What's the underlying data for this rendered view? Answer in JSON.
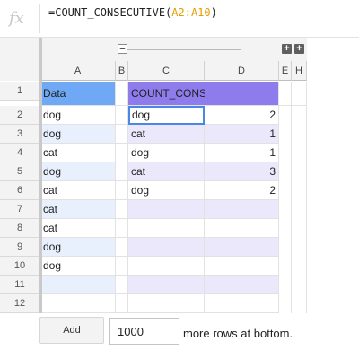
{
  "formula_bar": {
    "fx_icon": "fx-icon",
    "formula_prefix": "=COUNT_CONSECUTIVE(",
    "formula_ref": "A2:A10",
    "formula_suffix": ")"
  },
  "group_controls": {
    "collapse": "−",
    "level1": "+",
    "level2": "+"
  },
  "columns": [
    "A",
    "B",
    "C",
    "D",
    "E",
    "H"
  ],
  "rows": [
    "1",
    "2",
    "3",
    "4",
    "5",
    "6",
    "7",
    "8",
    "9",
    "10",
    "11",
    "12"
  ],
  "colors": {
    "header_a1": "#6fa8f5",
    "header_c1": "#8e7cec",
    "band_blue": "#e8f0fe",
    "band_purple": "#ece8fb",
    "selected_border": "#4a86e8",
    "formula_ref": "#e69b00"
  },
  "cells": {
    "A1": "Data",
    "C1": "COUNT_CONSECUTIVE",
    "A": [
      "dog",
      "dog",
      "cat",
      "dog",
      "cat",
      "cat",
      "cat",
      "dog",
      "dog",
      ""
    ],
    "C": [
      "dog",
      "cat",
      "dog",
      "cat",
      "dog"
    ],
    "D": [
      "2",
      "1",
      "1",
      "3",
      "2"
    ]
  },
  "add_rows": {
    "button_label": "Add",
    "input_value": "1000",
    "suffix_text": "more rows at bottom."
  }
}
